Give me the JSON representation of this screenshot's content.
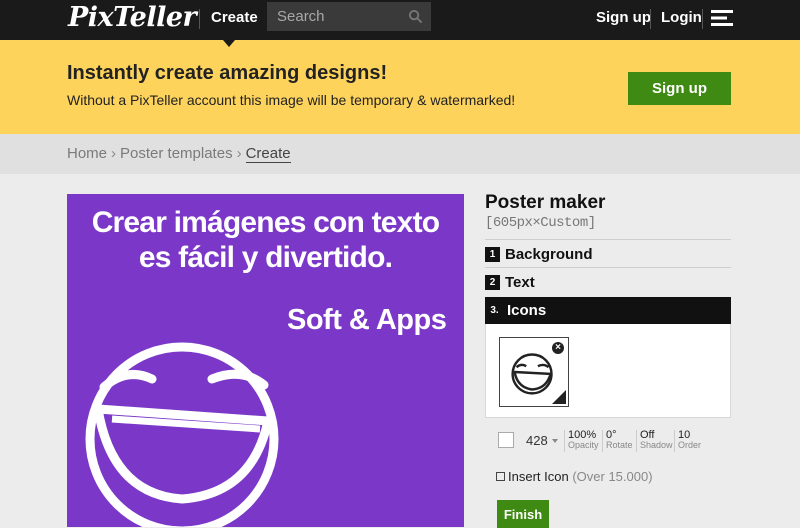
{
  "nav": {
    "logo": "PixTeller",
    "create_label": "Create",
    "search_placeholder": "Search",
    "signup_label": "Sign up",
    "login_label": "Login"
  },
  "banner": {
    "title": "Instantly create amazing designs!",
    "subtitle": "Without a PixTeller account this image will be temporary & watermarked!",
    "button_label": "Sign up",
    "background": "#fdd35c",
    "button_color": "#3f8a12"
  },
  "breadcrumb": {
    "items": [
      "Home",
      "Poster templates",
      "Create"
    ],
    "separator": "›"
  },
  "poster": {
    "background": "#7b38c8",
    "line1": "Crear imágenes con texto",
    "line2": "es fácil y divertido.",
    "brand": "Soft & Apps",
    "icon": "laughing-face-icon"
  },
  "panel": {
    "title": "Poster maker",
    "size": "[605px×Custom]",
    "sections": [
      {
        "num": "1",
        "label": "Background"
      },
      {
        "num": "2",
        "label": "Text"
      },
      {
        "num": "3.",
        "label": "Icons"
      }
    ],
    "icon_props": {
      "size": "428",
      "opacity_value": "100%",
      "opacity_caption": "Opacity",
      "rotate_value": "0°",
      "rotate_caption": "Rotate",
      "shadow_value": "Off",
      "shadow_caption": "Shadow",
      "order_value": "10",
      "order_caption": "Order"
    },
    "insert_label": "Insert Icon",
    "insert_count": "(Over 15.000)",
    "finish_label": "Finish"
  }
}
